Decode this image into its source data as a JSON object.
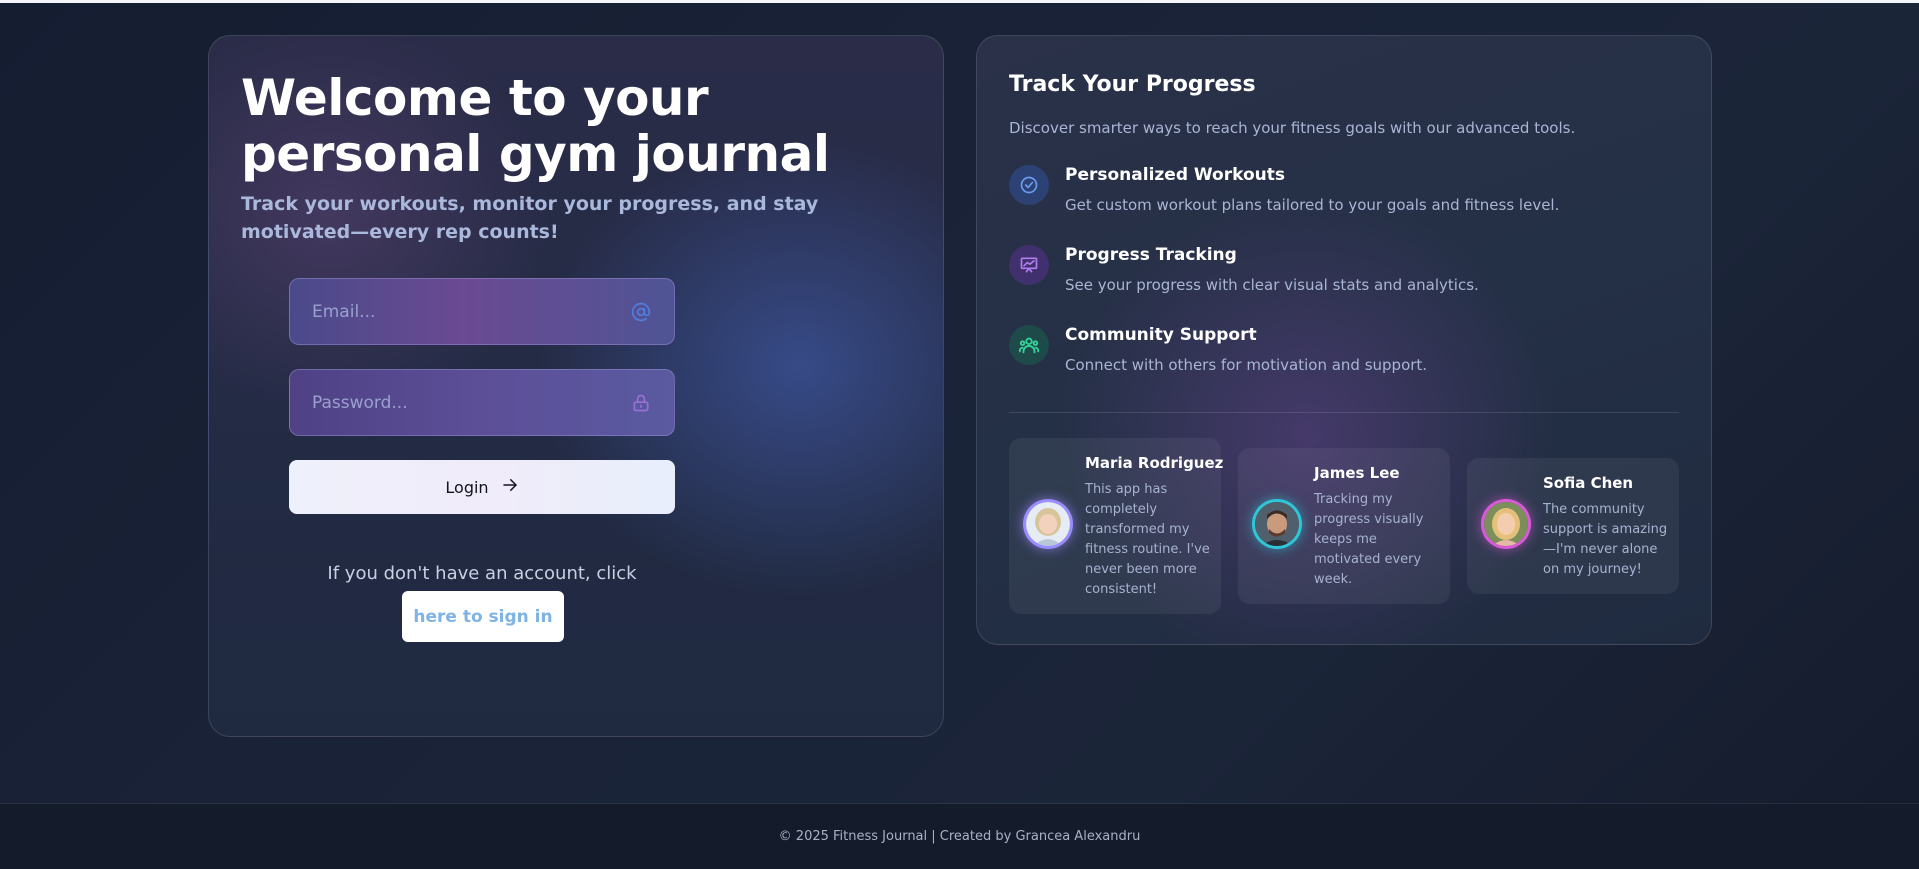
{
  "hero": {
    "title": "Welcome to your personal gym journal",
    "subtitle": "Track your workouts, monitor your progress, and stay motivated—every rep counts!"
  },
  "login_form": {
    "email_placeholder": "Email...",
    "password_placeholder": "Password...",
    "login_label": "Login",
    "signup_prompt": "If you don't have an account, click",
    "signup_link": "here to sign in"
  },
  "progress_panel": {
    "title": "Track Your Progress",
    "subtitle": "Discover smarter ways to reach your fitness goals with our advanced tools.",
    "features": [
      {
        "title": "Personalized Workouts",
        "description": "Get custom workout plans tailored to your goals and fitness level.",
        "icon": "check-circle-icon",
        "color": "#5b8ee8"
      },
      {
        "title": "Progress Tracking",
        "description": "See your progress with clear visual stats and analytics.",
        "icon": "chart-board-icon",
        "color": "#a06ee0"
      },
      {
        "title": "Community Support",
        "description": "Connect with others for motivation and support.",
        "icon": "users-icon",
        "color": "#34d39a"
      }
    ],
    "testimonials": [
      {
        "name": "Maria Rodriguez",
        "text": "This app has completely transformed my fitness routine. I've never been more consistent!",
        "ring_color": "#9b8cff"
      },
      {
        "name": "James Lee",
        "text": "Tracking my progress visually keeps me motivated every week.",
        "ring_color": "#2fc6d8"
      },
      {
        "name": "Sofia Chen",
        "text": "The community support is amazing—I'm never alone on my journey!",
        "ring_color": "#d95ad8"
      }
    ]
  },
  "footer": {
    "text": "© 2025 Fitness Journal | Created by Grancea Alexandru"
  },
  "icons": {
    "email": "at-sign-icon",
    "password": "lock-icon",
    "login": "arrow-right-icon"
  }
}
